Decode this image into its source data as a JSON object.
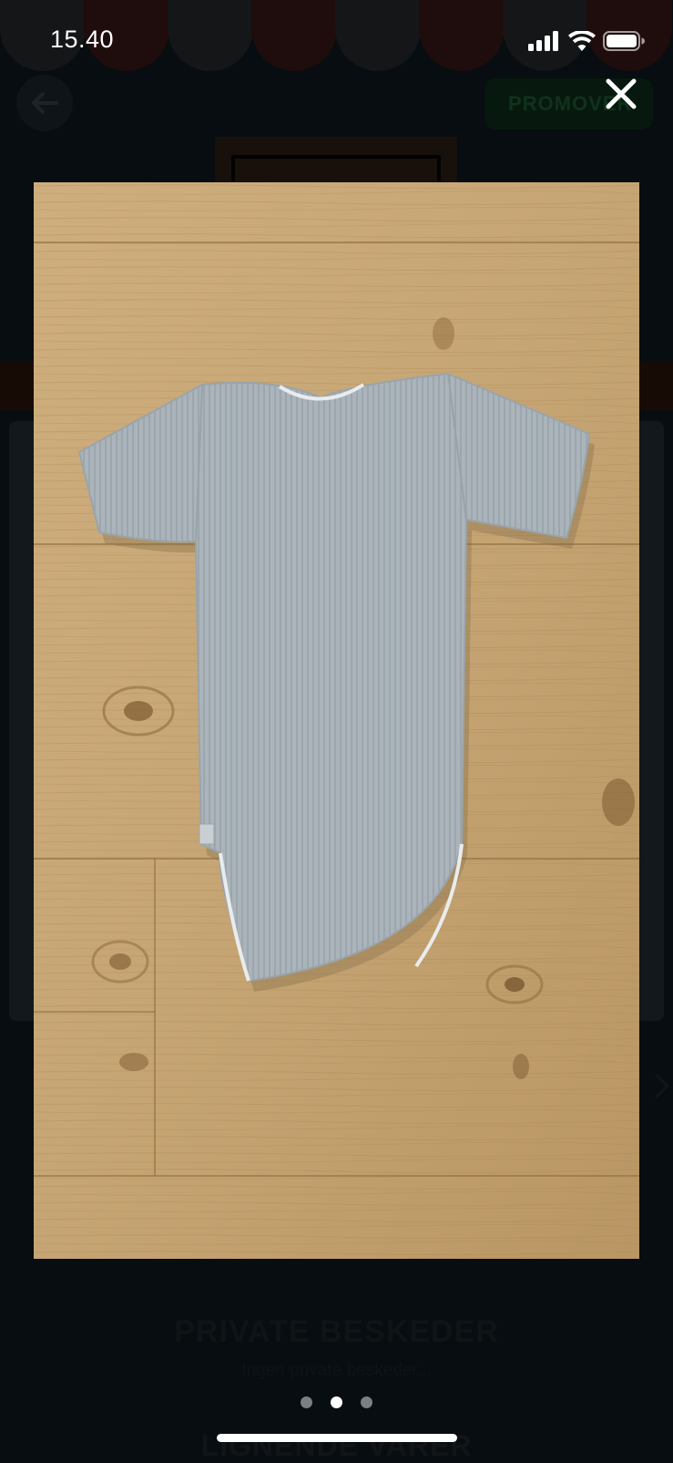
{
  "status_bar": {
    "time": "15.40",
    "icons": [
      "cellular-signal-icon",
      "wifi-icon",
      "battery-icon"
    ]
  },
  "background_page": {
    "promote_button_label": "PROMOVER",
    "private_messages_title": "PRIVATE BESKEDER",
    "private_messages_empty": "Ingen private beskeder...",
    "similar_items_title": "LIGNENDE VARER"
  },
  "viewer": {
    "close_icon": "close-icon",
    "pager": {
      "total": 3,
      "active_index": 1
    }
  },
  "colors": {
    "page_background": "#070d10",
    "wood": "#c9a878",
    "bodysuit": "#a9b3b9",
    "pager_active": "#ffffff",
    "pager_inactive": "#7b7f82",
    "promote_button": "#07190e"
  }
}
